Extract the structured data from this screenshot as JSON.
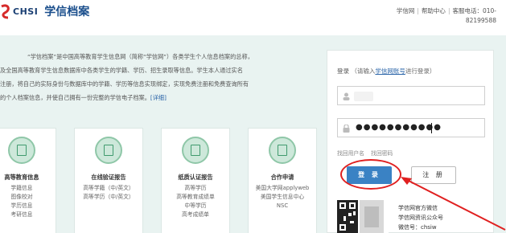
{
  "header": {
    "logo_text": "CHSI",
    "site_title": "学信档案",
    "toplinks": [
      "学信网",
      "帮助中心"
    ],
    "hotline_label": "客服电话：010-",
    "hotline_number": "82199588"
  },
  "intro": {
    "line1": "“学信档案”是中国高等教育学生信息网（简称“学信网”）各类学生个人信息档案的总称，",
    "line2": "及全国高等教育学生信息数据库中各类学生的学籍、学历、招生录取等信息。学生本人通过实名",
    "line3": "注册，将自己的实际身份与数据库中的学籍、学历等信息实现绑定，实现免费注册和免费查询所有",
    "line4": "的个人档案信息，并使自己拥有一份完整的学信电子档案。",
    "more": "[详细]"
  },
  "cards": [
    {
      "title": "高等教育信息",
      "lines": [
        "学籍信息",
        "图像校对",
        "学历信息",
        "考研信息"
      ]
    },
    {
      "title": "在线验证报告",
      "lines": [
        "高等学籍（中/英文）",
        "高等学历（中/英文）"
      ]
    },
    {
      "title": "纸质认证报告",
      "lines": [
        "高等学历",
        "高等教育成绩单",
        "中等学历",
        "高考成绩单"
      ]
    },
    {
      "title": "合作申请",
      "lines": [
        "美国大学网applyweb",
        "美国学生信息中心",
        "NSC"
      ]
    }
  ],
  "login": {
    "label": "登录",
    "hint_prefix": "（请输入",
    "hint_link": "学信网账号",
    "hint_suffix": "进行登录）",
    "password_mask": "●●●●●●●●●●●",
    "forgot_username": "找回用户名",
    "forgot_password": "找回密码",
    "login_button": "登 录",
    "register_button": "注 册",
    "wechat_lines": [
      "学信网官方微信",
      "学信网资讯公众号",
      "微信号：chsiw"
    ]
  },
  "colors": {
    "band_bg": "#e9f3f1",
    "primary_blue": "#3a82c4",
    "annotation_red": "#e02020",
    "card_icon_green": "#3f9a6d"
  }
}
